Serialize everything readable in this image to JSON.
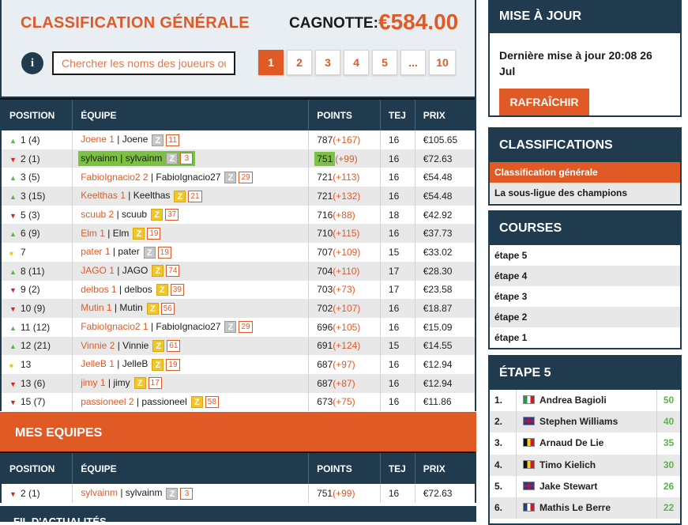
{
  "header": {
    "title": "CLASSIFICATION GÉNÉRALE",
    "pot_label": "CAGNOTTE:",
    "pot_value": "€584.00",
    "info_label": "i",
    "search_placeholder": "Chercher les noms des joueurs ou des équipes",
    "pages": [
      "1",
      "2",
      "3",
      "4",
      "5",
      "...",
      "10"
    ],
    "active_page": "1"
  },
  "columns": [
    "POSITION",
    "ÉQUIPE",
    "POINTS",
    "TEJ",
    "PRIX"
  ],
  "rows": [
    {
      "trend": "up",
      "pos": "1 (4)",
      "team": "Joene 1",
      "player": "Joene",
      "badge": "grey",
      "num": "11",
      "points": "787",
      "gain": "(+167)",
      "tej": "16",
      "prize": "€105.65"
    },
    {
      "trend": "down",
      "pos": "2 (1)",
      "team": "sylvainm",
      "player": "sylvainm",
      "badge": "grey",
      "num": "3",
      "points": "751",
      "gain": "(+99)",
      "tej": "16",
      "prize": "€72.63",
      "highlight": true
    },
    {
      "trend": "up",
      "pos": "3 (5)",
      "team": "FabioIgnacio2 2",
      "player": "FabioIgnacio27",
      "badge": "grey",
      "num": "29",
      "points": "721",
      "gain": "(+113)",
      "tej": "16",
      "prize": "€54.48"
    },
    {
      "trend": "up",
      "pos": "3 (15)",
      "team": "Keelthas 1",
      "player": "Keelthas",
      "badge": "gold",
      "num": "21",
      "points": "721",
      "gain": "(+132)",
      "tej": "16",
      "prize": "€54.48"
    },
    {
      "trend": "down",
      "pos": "5 (3)",
      "team": "scuub 2",
      "player": "scuub",
      "badge": "gold",
      "num": "37",
      "points": "716",
      "gain": "(+88)",
      "tej": "18",
      "prize": "€42.92"
    },
    {
      "trend": "up",
      "pos": "6 (9)",
      "team": "Elm 1",
      "player": "Elm",
      "badge": "gold",
      "num": "19",
      "points": "710",
      "gain": "(+115)",
      "tej": "16",
      "prize": "€37.73"
    },
    {
      "trend": "same",
      "pos": "7",
      "team": "pater 1",
      "player": "pater",
      "badge": "grey",
      "num": "19",
      "points": "707",
      "gain": "(+109)",
      "tej": "15",
      "prize": "€33.02"
    },
    {
      "trend": "up",
      "pos": "8 (11)",
      "team": "JAGO 1",
      "player": "JAGO",
      "badge": "gold",
      "num": "74",
      "points": "704",
      "gain": "(+110)",
      "tej": "17",
      "prize": "€28.30"
    },
    {
      "trend": "down",
      "pos": "9 (2)",
      "team": "delbos 1",
      "player": "delbos",
      "badge": "gold",
      "num": "39",
      "points": "703",
      "gain": "(+73)",
      "tej": "17",
      "prize": "€23.58"
    },
    {
      "trend": "down",
      "pos": "10 (9)",
      "team": "Mutin 1",
      "player": "Mutin",
      "badge": "gold",
      "num": "56",
      "points": "702",
      "gain": "(+107)",
      "tej": "16",
      "prize": "€18.87"
    },
    {
      "trend": "up",
      "pos": "11 (12)",
      "team": "FabioIgnacio2 1",
      "player": "FabioIgnacio27",
      "badge": "grey",
      "num": "29",
      "points": "696",
      "gain": "(+105)",
      "tej": "16",
      "prize": "€15.09"
    },
    {
      "trend": "up",
      "pos": "12 (21)",
      "team": "Vinnie 2",
      "player": "Vinnie",
      "badge": "gold",
      "num": "61",
      "points": "691",
      "gain": "(+124)",
      "tej": "15",
      "prize": "€14.55"
    },
    {
      "trend": "same",
      "pos": "13",
      "team": "JelleB 1",
      "player": "JelleB",
      "badge": "gold",
      "num": "19",
      "points": "687",
      "gain": "(+97)",
      "tej": "16",
      "prize": "€12.94"
    },
    {
      "trend": "down",
      "pos": "13 (6)",
      "team": "jimy 1",
      "player": "jimy",
      "badge": "gold",
      "num": "17",
      "points": "687",
      "gain": "(+87)",
      "tej": "16",
      "prize": "€12.94"
    },
    {
      "trend": "down",
      "pos": "15 (7)",
      "team": "passioneel 2",
      "player": "passioneel",
      "badge": "gold",
      "num": "58",
      "points": "673",
      "gain": "(+75)",
      "tej": "16",
      "prize": "€11.86"
    }
  ],
  "my_teams": {
    "title": "MES EQUIPES",
    "rows": [
      {
        "trend": "down",
        "pos": "2 (1)",
        "team": "sylvainm",
        "player": "sylvainm",
        "badge": "grey",
        "num": "3",
        "points": "751",
        "gain": "(+99)",
        "tej": "16",
        "prize": "€72.63"
      }
    ]
  },
  "bottom_strip": "FIL D'ACTUALITÉS",
  "update": {
    "title": "MISE À JOUR",
    "text": "Dernière mise à jour 20:08 26 Jul",
    "button": "RAFRAÎCHIR"
  },
  "classifications": {
    "title": "CLASSIFICATIONS",
    "items": [
      "Classification générale",
      "La sous-ligue des champions"
    ],
    "active": 0
  },
  "courses": {
    "title": "COURSES",
    "items": [
      "étape 5",
      "étape 4",
      "étape 3",
      "étape 2",
      "étape 1"
    ]
  },
  "stage": {
    "title": "ÉTAPE 5",
    "rows": [
      {
        "rank": "1.",
        "flag": "it",
        "name": "Andrea Bagioli",
        "pts": "50"
      },
      {
        "rank": "2.",
        "flag": "gb",
        "name": "Stephen Williams",
        "pts": "40"
      },
      {
        "rank": "3.",
        "flag": "be",
        "name": "Arnaud De Lie",
        "pts": "35"
      },
      {
        "rank": "4.",
        "flag": "be",
        "name": "Timo Kielich",
        "pts": "30"
      },
      {
        "rank": "5.",
        "flag": "gb",
        "name": "Jake Stewart",
        "pts": "26"
      },
      {
        "rank": "6.",
        "flag": "fr",
        "name": "Mathis Le Berre",
        "pts": "22"
      }
    ]
  },
  "colors": {
    "accent": "#e05a26",
    "header_dark": "#1f3b4d",
    "positive": "#5cb34a",
    "negative": "#d5211e",
    "neutral": "#f2cb05",
    "highlight": "#7cc242"
  }
}
